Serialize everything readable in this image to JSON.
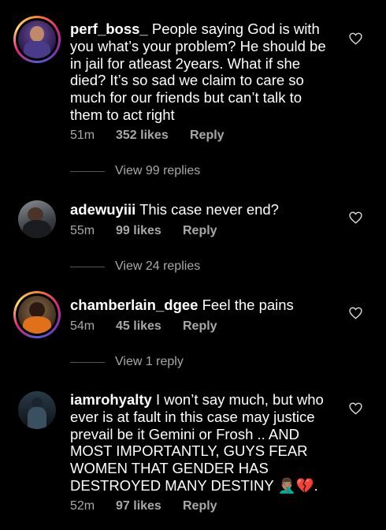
{
  "comments": [
    {
      "username": "perf_boss_",
      "text": "People saying God is with you what’s your problem? He should be in jail for atleast 2years. What if she died? It’s so sad we claim to care  so much for our friends but can’t talk to them to act right",
      "time": "51m",
      "likes": "352 likes",
      "reply_label": "Reply",
      "view_replies": "View 99 replies",
      "has_story_ring": true
    },
    {
      "username": "adewuyiii",
      "text": "This case never end?",
      "time": "55m",
      "likes": "99 likes",
      "reply_label": "Reply",
      "view_replies": "View 24 replies",
      "has_story_ring": false
    },
    {
      "username": "chamberlain_dgee",
      "text": "Feel the pains",
      "time": "54m",
      "likes": "45 likes",
      "reply_label": "Reply",
      "view_replies": "View 1 reply",
      "has_story_ring": true
    },
    {
      "username": "iamrohyalty",
      "text": "I won’t say much, but who ever is at fault in this case may justice prevail be it Gemini or Frosh .. AND MOST IMPORTANTLY, GUYS FEAR WOMEN THAT GENDER HAS DESTROYED MANY DESTINY 🤦🏽‍♂️💔.",
      "time": "52m",
      "likes": "97 likes",
      "reply_label": "Reply",
      "has_story_ring": false
    }
  ],
  "icons": {
    "like": "heart-outline-icon"
  },
  "colors": {
    "background": "#000000",
    "primary_text": "#ffffff",
    "secondary_text": "#a8a8a8"
  }
}
